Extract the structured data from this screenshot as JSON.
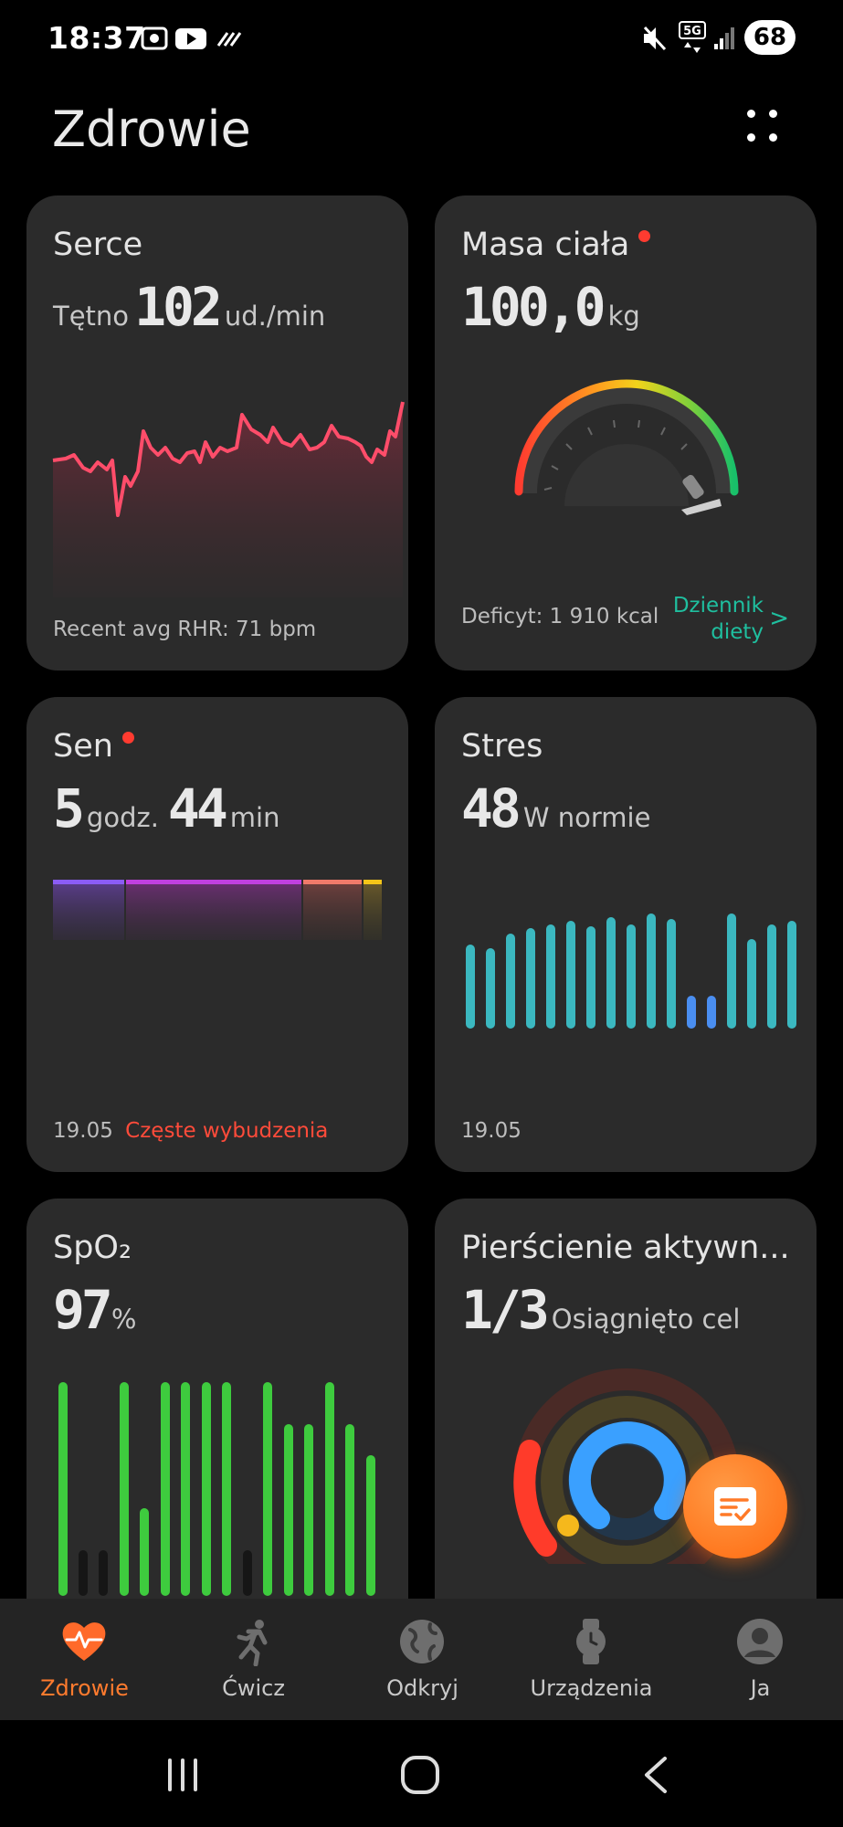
{
  "status_bar": {
    "time": "18:37",
    "battery": "68"
  },
  "header": {
    "title": "Zdrowie"
  },
  "cards": {
    "heart": {
      "title": "Serce",
      "metric_label": "Tętno",
      "value": "102",
      "unit": "ud./min",
      "footer": "Recent avg RHR: 71 bpm",
      "accent": "#ff4d6a"
    },
    "weight": {
      "title": "Masa ciała",
      "value": "100,0",
      "unit": "kg",
      "deficit": "Deficyt: 1 910 kcal",
      "link_line1": "Dziennik",
      "link_line2": "diety",
      "link_chevron": ">",
      "accent": "#1fbf9f"
    },
    "sleep": {
      "title": "Sen",
      "hours": "5",
      "hours_unit": "godz.",
      "minutes": "44",
      "minutes_unit": "min",
      "date": "19.05",
      "note": "Częste wybudzenia",
      "note_color": "#ff4b3a"
    },
    "stress": {
      "title": "Stres",
      "value": "48",
      "status": "W normie",
      "date": "19.05"
    },
    "spo2": {
      "title": "SpO₂",
      "value": "97",
      "unit": "%"
    },
    "rings": {
      "title": "Pierścienie aktywn...",
      "value": "1/3",
      "status": "Osiągnięto cel"
    }
  },
  "bottom_nav": {
    "items": [
      {
        "label": "Zdrowie",
        "icon": "heart-pulse-icon",
        "active": true
      },
      {
        "label": "Ćwicz",
        "icon": "running-icon",
        "active": false
      },
      {
        "label": "Odkryj",
        "icon": "globe-icon",
        "active": false
      },
      {
        "label": "Urządzenia",
        "icon": "watch-icon",
        "active": false
      },
      {
        "label": "Ja",
        "icon": "user-icon",
        "active": false
      }
    ],
    "active_color": "#ff7b2e"
  }
}
